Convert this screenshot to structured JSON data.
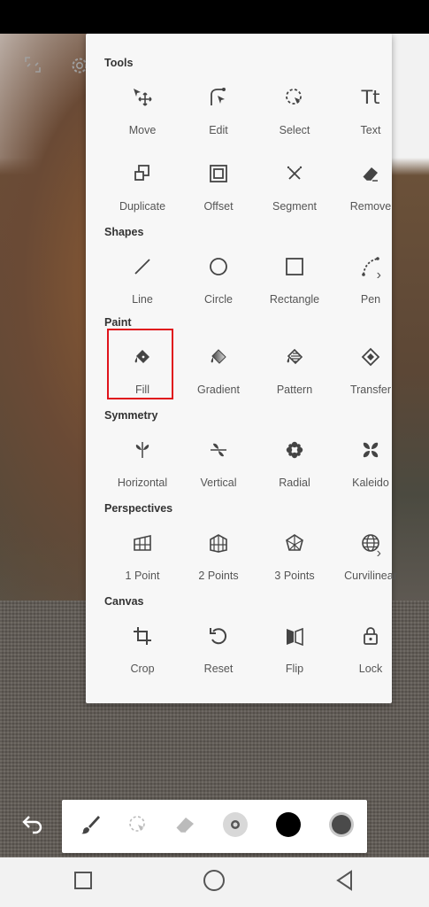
{
  "sections": {
    "tools": "Tools",
    "shapes": "Shapes",
    "paint": "Paint",
    "symmetry": "Symmetry",
    "perspectives": "Perspectives",
    "canvas": "Canvas"
  },
  "tools": [
    "Move",
    "Edit",
    "Select",
    "Text",
    "Duplicate",
    "Offset",
    "Segment",
    "Remove"
  ],
  "shapes": [
    "Line",
    "Circle",
    "Rectangle",
    "Pen"
  ],
  "paint": [
    "Fill",
    "Gradient",
    "Pattern",
    "Transfer"
  ],
  "symmetry": [
    "Horizontal",
    "Vertical",
    "Radial",
    "Kaleido"
  ],
  "perspectives": [
    "1 Point",
    "2 Points",
    "3 Points",
    "Curvilinear"
  ],
  "canvas": [
    "Crop",
    "Reset",
    "Flip",
    "Lock"
  ],
  "text_tool_glyph": "Tt",
  "more_glyph": "›",
  "selected_tool": "Fill",
  "colors": {
    "highlight": "#e0141c",
    "current_color": "#000000"
  }
}
